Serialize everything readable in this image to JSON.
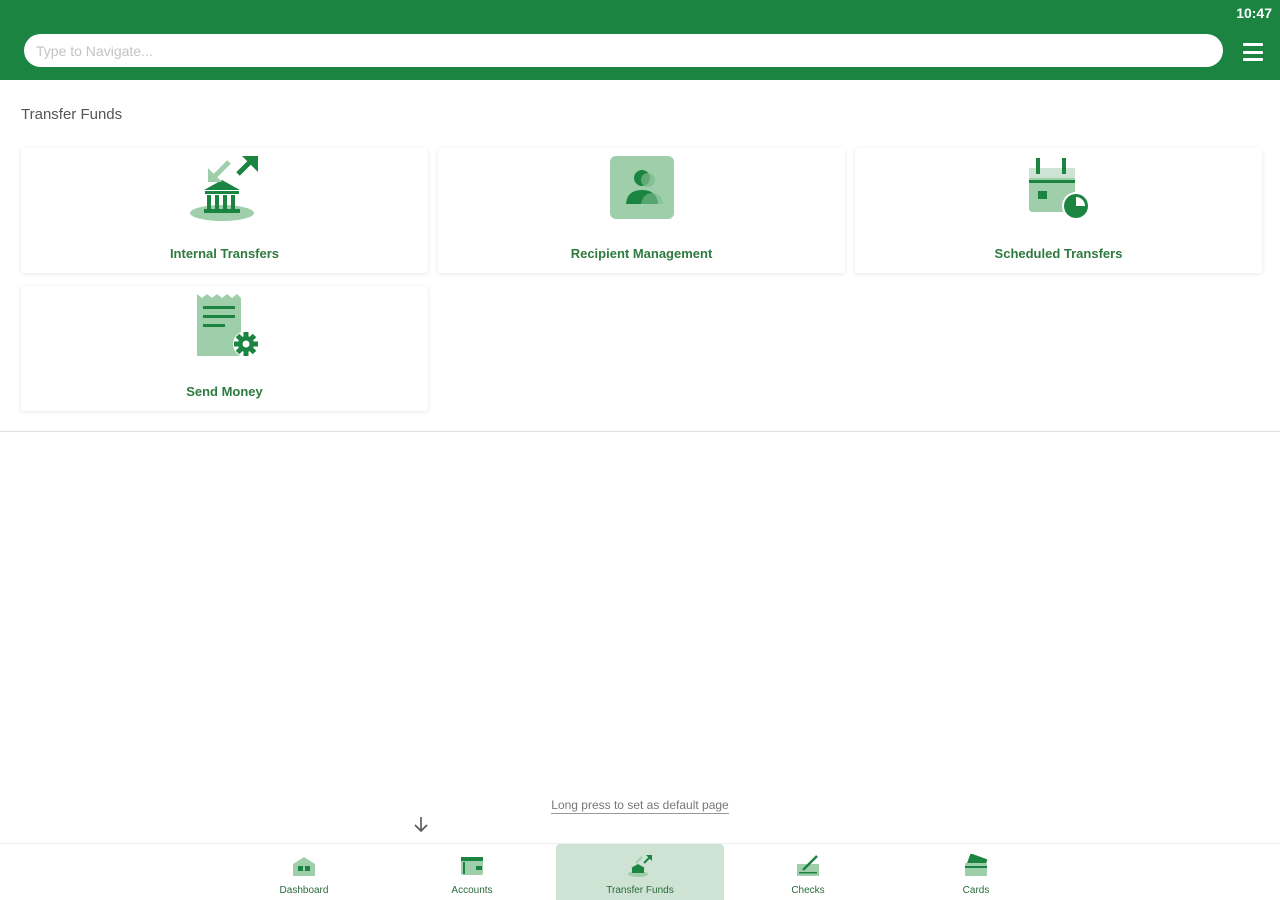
{
  "status": {
    "time": "10:47"
  },
  "header": {
    "search_placeholder": "Type to Navigate...",
    "menu_icon": "hamburger-icon"
  },
  "section": {
    "title": "Transfer Funds",
    "tiles": [
      {
        "label": "Internal Transfers",
        "icon": "bank-transfer-icon"
      },
      {
        "label": "Recipient Management",
        "icon": "person-icon"
      },
      {
        "label": "Scheduled Transfers",
        "icon": "calendar-clock-icon"
      },
      {
        "label": "Send Money",
        "icon": "document-gear-icon"
      }
    ]
  },
  "hint": "Long press to set as default page",
  "bottom_nav": {
    "active": "Transfer Funds",
    "items": [
      {
        "label": "Dashboard",
        "icon": "dashboard-icon"
      },
      {
        "label": "Accounts",
        "icon": "wallet-icon"
      },
      {
        "label": "Transfer Funds",
        "icon": "transfer-icon"
      },
      {
        "label": "Checks",
        "icon": "check-pen-icon"
      },
      {
        "label": "Cards",
        "icon": "card-icon"
      }
    ]
  },
  "colors": {
    "brand_green": "#1b8441",
    "icon_light_green": "#9fcfaa",
    "label_green": "#2f7a3f",
    "active_nav_bg": "#cfe3d4"
  }
}
